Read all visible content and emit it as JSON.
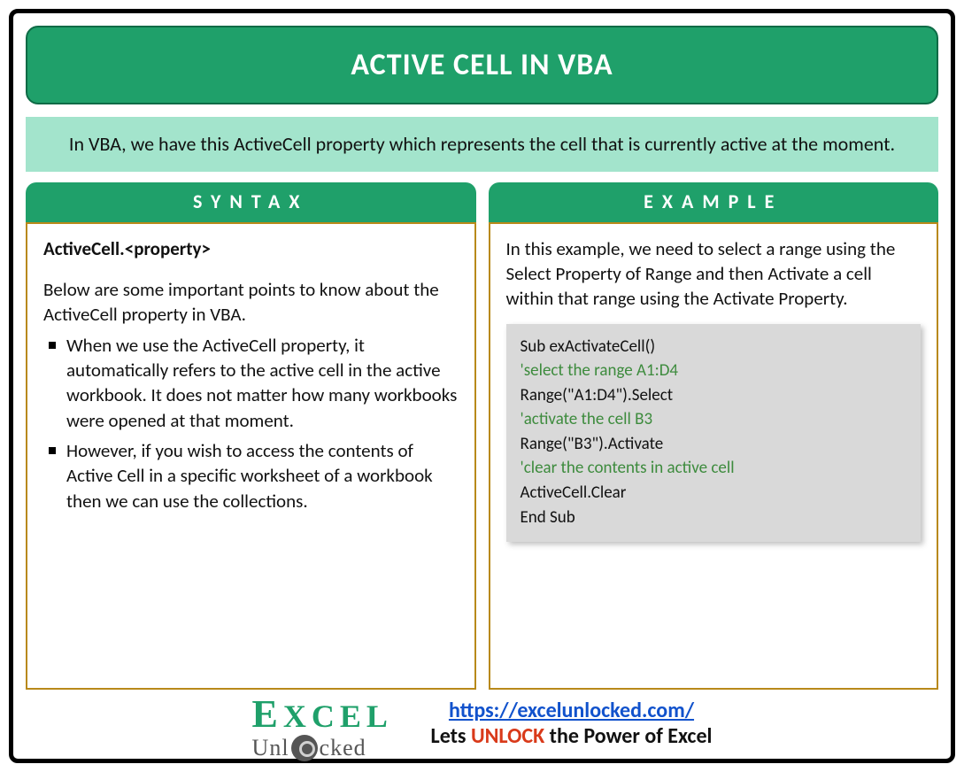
{
  "title": "ACTIVE CELL IN VBA",
  "intro": "In VBA, we have this ActiveCell property which represents the cell that is currently active at the moment.",
  "columns": {
    "syntax": {
      "header": "SYNTAX",
      "signature": "ActiveCell.<property>",
      "lead": "Below are some important points to know about the ActiveCell property in VBA.",
      "bullets": [
        "When we use the ActiveCell property, it automatically refers to the active cell in the active workbook. It does not matter how many workbooks were opened at that moment.",
        "However, if you wish to access the contents of Active Cell in a specific worksheet of a workbook then we can use the collections."
      ]
    },
    "example": {
      "header": "EXAMPLE",
      "lead": "In this example, we need to select a range using the Select Property of Range and then Activate a cell within that range using the Activate Property.",
      "code": [
        {
          "t": "Sub exActivateCell()",
          "c": false
        },
        {
          "t": "'select the range A1:D4",
          "c": true
        },
        {
          "t": "Range(\"A1:D4\").Select",
          "c": false
        },
        {
          "t": "'activate the cell B3",
          "c": true
        },
        {
          "t": "Range(\"B3\").Activate",
          "c": false
        },
        {
          "t": "'clear the contents in active cell",
          "c": true
        },
        {
          "t": "ActiveCell.Clear",
          "c": false
        },
        {
          "t": "End Sub",
          "c": false
        }
      ]
    }
  },
  "footer": {
    "logo_top": "EXCEL",
    "logo_bottom_left": "Unl",
    "logo_bottom_right": "cked",
    "url": "https://excelunlocked.com/",
    "tagline_pre": "Lets ",
    "tagline_em": "UNLOCK",
    "tagline_post": " the Power of Excel"
  }
}
